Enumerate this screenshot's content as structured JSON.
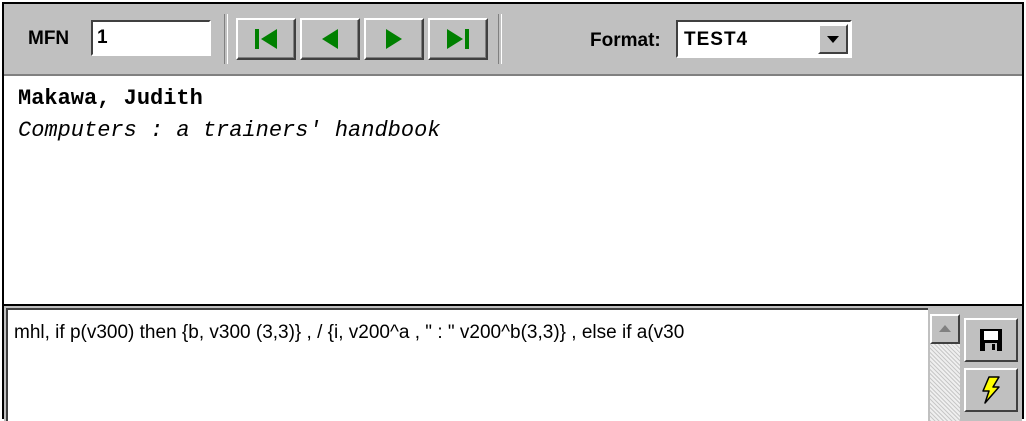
{
  "toolbar": {
    "mfn_label": "MFN",
    "mfn_value": "1",
    "nav_buttons": [
      {
        "name": "first-record-button",
        "icon": "first-icon"
      },
      {
        "name": "previous-record-button",
        "icon": "previous-icon"
      },
      {
        "name": "next-record-button",
        "icon": "next-icon"
      },
      {
        "name": "last-record-button",
        "icon": "last-icon"
      }
    ],
    "format_label": "Format:",
    "format_value": "TEST4",
    "colors": {
      "nav_icon": "#008000",
      "face": "#c0c0c0"
    }
  },
  "display": {
    "author": "Makawa, Judith",
    "title": "Computers : a trainers' handbook"
  },
  "editor": {
    "text": "mhl, if p(v300) then {b, v300 (3,3)} , / {i, v200^a , \" : \" v200^b(3,3)} , else if a(v30"
  },
  "side_buttons": [
    {
      "name": "save-button",
      "icon": "floppy-disk-icon"
    },
    {
      "name": "run-button",
      "icon": "lightning-icon",
      "icon_color": "#ffff00"
    }
  ]
}
